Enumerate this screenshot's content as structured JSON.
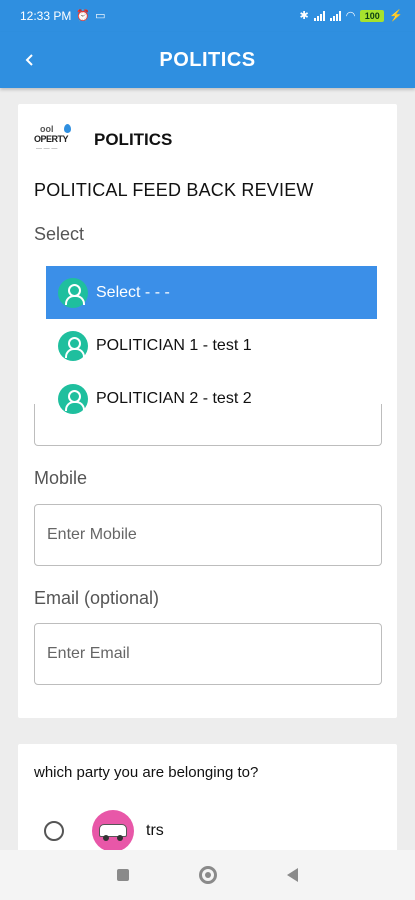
{
  "status_bar": {
    "time": "12:33 PM",
    "battery": "100"
  },
  "app_bar": {
    "title": "POLITICS"
  },
  "org": {
    "name": "POLITICS",
    "logo_text": "OPERTY"
  },
  "form": {
    "title": "POLITICAL FEED BACK REVIEW",
    "select_label": "Select",
    "options": [
      {
        "label": "Select  - - -",
        "selected": true
      },
      {
        "label": "POLITICIAN 1 - test 1",
        "selected": false
      },
      {
        "label": "POLITICIAN 2 - test 2",
        "selected": false
      }
    ],
    "mobile_label": "Mobile",
    "mobile_placeholder": "Enter Mobile",
    "mobile_value": "",
    "email_label": "Email (optional)",
    "email_placeholder": "Enter Email",
    "email_value": ""
  },
  "party": {
    "question": "which party  you are belonging to?",
    "options": [
      {
        "name": "trs",
        "selected": false
      }
    ]
  },
  "colors": {
    "primary": "#2f8fe0",
    "selected_option": "#3b8fe8",
    "avatar": "#1fbf9e",
    "party_logo": "#e857a8"
  },
  "icons": {
    "back": "arrow-left-icon",
    "option_avatar": "person-icon",
    "nav": [
      "recents-square-icon",
      "home-circle-icon",
      "back-triangle-icon"
    ]
  }
}
